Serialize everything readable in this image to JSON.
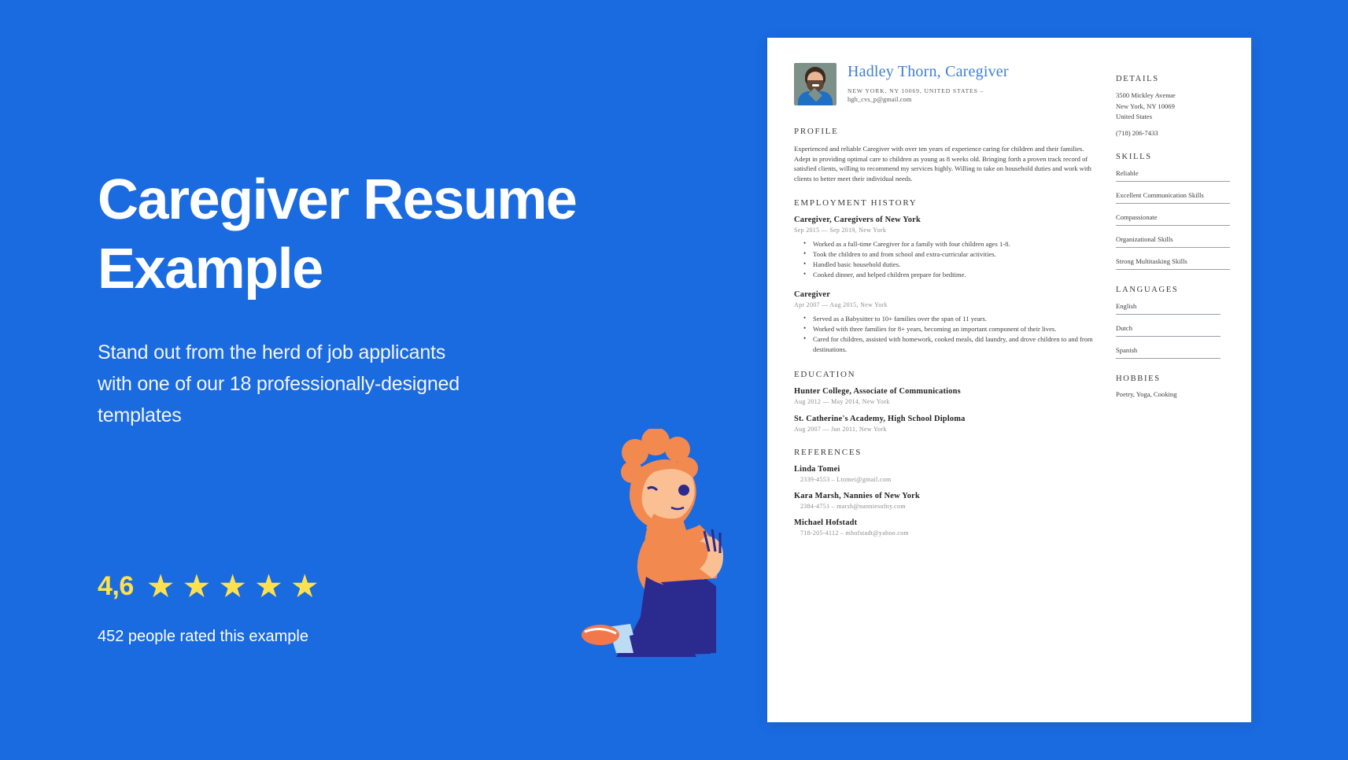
{
  "promo": {
    "title": "Caregiver Resume Example",
    "subtitle": "Stand out from the herd of job applicants with one of our 18 professionally-designed templates",
    "rating_score": "4,6",
    "rating_caption": "452 people rated this example",
    "star_glyph": "★",
    "star_count": 5,
    "background_color": "#1a6ae0",
    "star_color": "#ffe14d"
  },
  "resume": {
    "header": {
      "name": "Hadley Thorn, Caregiver",
      "location_line": "NEW YORK, NY 10069, UNITED STATES  –",
      "email": "hgh_cvs_p@gmail.com",
      "name_color": "#3f7fd4"
    },
    "profile": {
      "heading": "PROFILE",
      "text": "Experienced and reliable Caregiver with over ten years of experience caring for children and their families. Adept in providing optimal care to children as young as 8 weeks old. Bringing forth a proven track record of satisfied clients, willing to recommend my services highly. Willing to take on household duties and work with clients to better meet their individual needs."
    },
    "employment": {
      "heading": "EMPLOYMENT HISTORY",
      "jobs": [
        {
          "title": "Caregiver, Caregivers of New York",
          "meta": "Sep 2015 — Sep 2019, New York",
          "bullets": [
            "Worked as a full-time Caregiver for a family with four children ages 1-8.",
            "Took the children to and from school and extra-curricular activities.",
            "Handled basic household duties.",
            "Cooked dinner, and helped children prepare for bedtime."
          ]
        },
        {
          "title": "Caregiver",
          "meta": "Apr 2007 — Aug 2015, New York",
          "bullets": [
            "Served as a Babysitter to 10+ families over the span of 11 years.",
            "Worked with three families for 8+ years, becoming an important component of their lives.",
            "Cared for children, assisted with homework, cooked meals, did laundry, and drove children to and from destinations."
          ]
        }
      ]
    },
    "education": {
      "heading": "EDUCATION",
      "entries": [
        {
          "title": "Hunter College, Associate of Communications",
          "meta": "Aug 2012 — May 2014, New York"
        },
        {
          "title": "St. Catherine's Academy, High School Diploma",
          "meta": "Aug 2007 — Jun 2011, New York"
        }
      ]
    },
    "references": {
      "heading": "REFERENCES",
      "entries": [
        {
          "name": "Linda Tomei",
          "meta": "2339-4553 – Ltomei@gmail.com"
        },
        {
          "name": "Kara Marsh, Nannies of New York",
          "meta": "2384-4751 – marsh@nanniesofny.com"
        },
        {
          "name": "Michael Hofstadt",
          "meta": "718-205-4112 – mhofstadt@yahoo.com"
        }
      ]
    },
    "sidebar": {
      "details": {
        "heading": "DETAILS",
        "address_line1": "3500 Mickley Avenue",
        "address_line2": "New York, NY 10069",
        "address_line3": "United States",
        "phone": "(718) 206-7433"
      },
      "skills": {
        "heading": "SKILLS",
        "items": [
          "Reliable",
          "Excellent Communication Skills",
          "Compassionate",
          "Organizational Skills",
          "Strong Multitasking Skills"
        ]
      },
      "languages": {
        "heading": "LANGUAGES",
        "items": [
          "English",
          "Dutch",
          "Spanish"
        ]
      },
      "hobbies": {
        "heading": "HOBBIES",
        "text": "Poetry, Yoga, Cooking"
      }
    }
  }
}
